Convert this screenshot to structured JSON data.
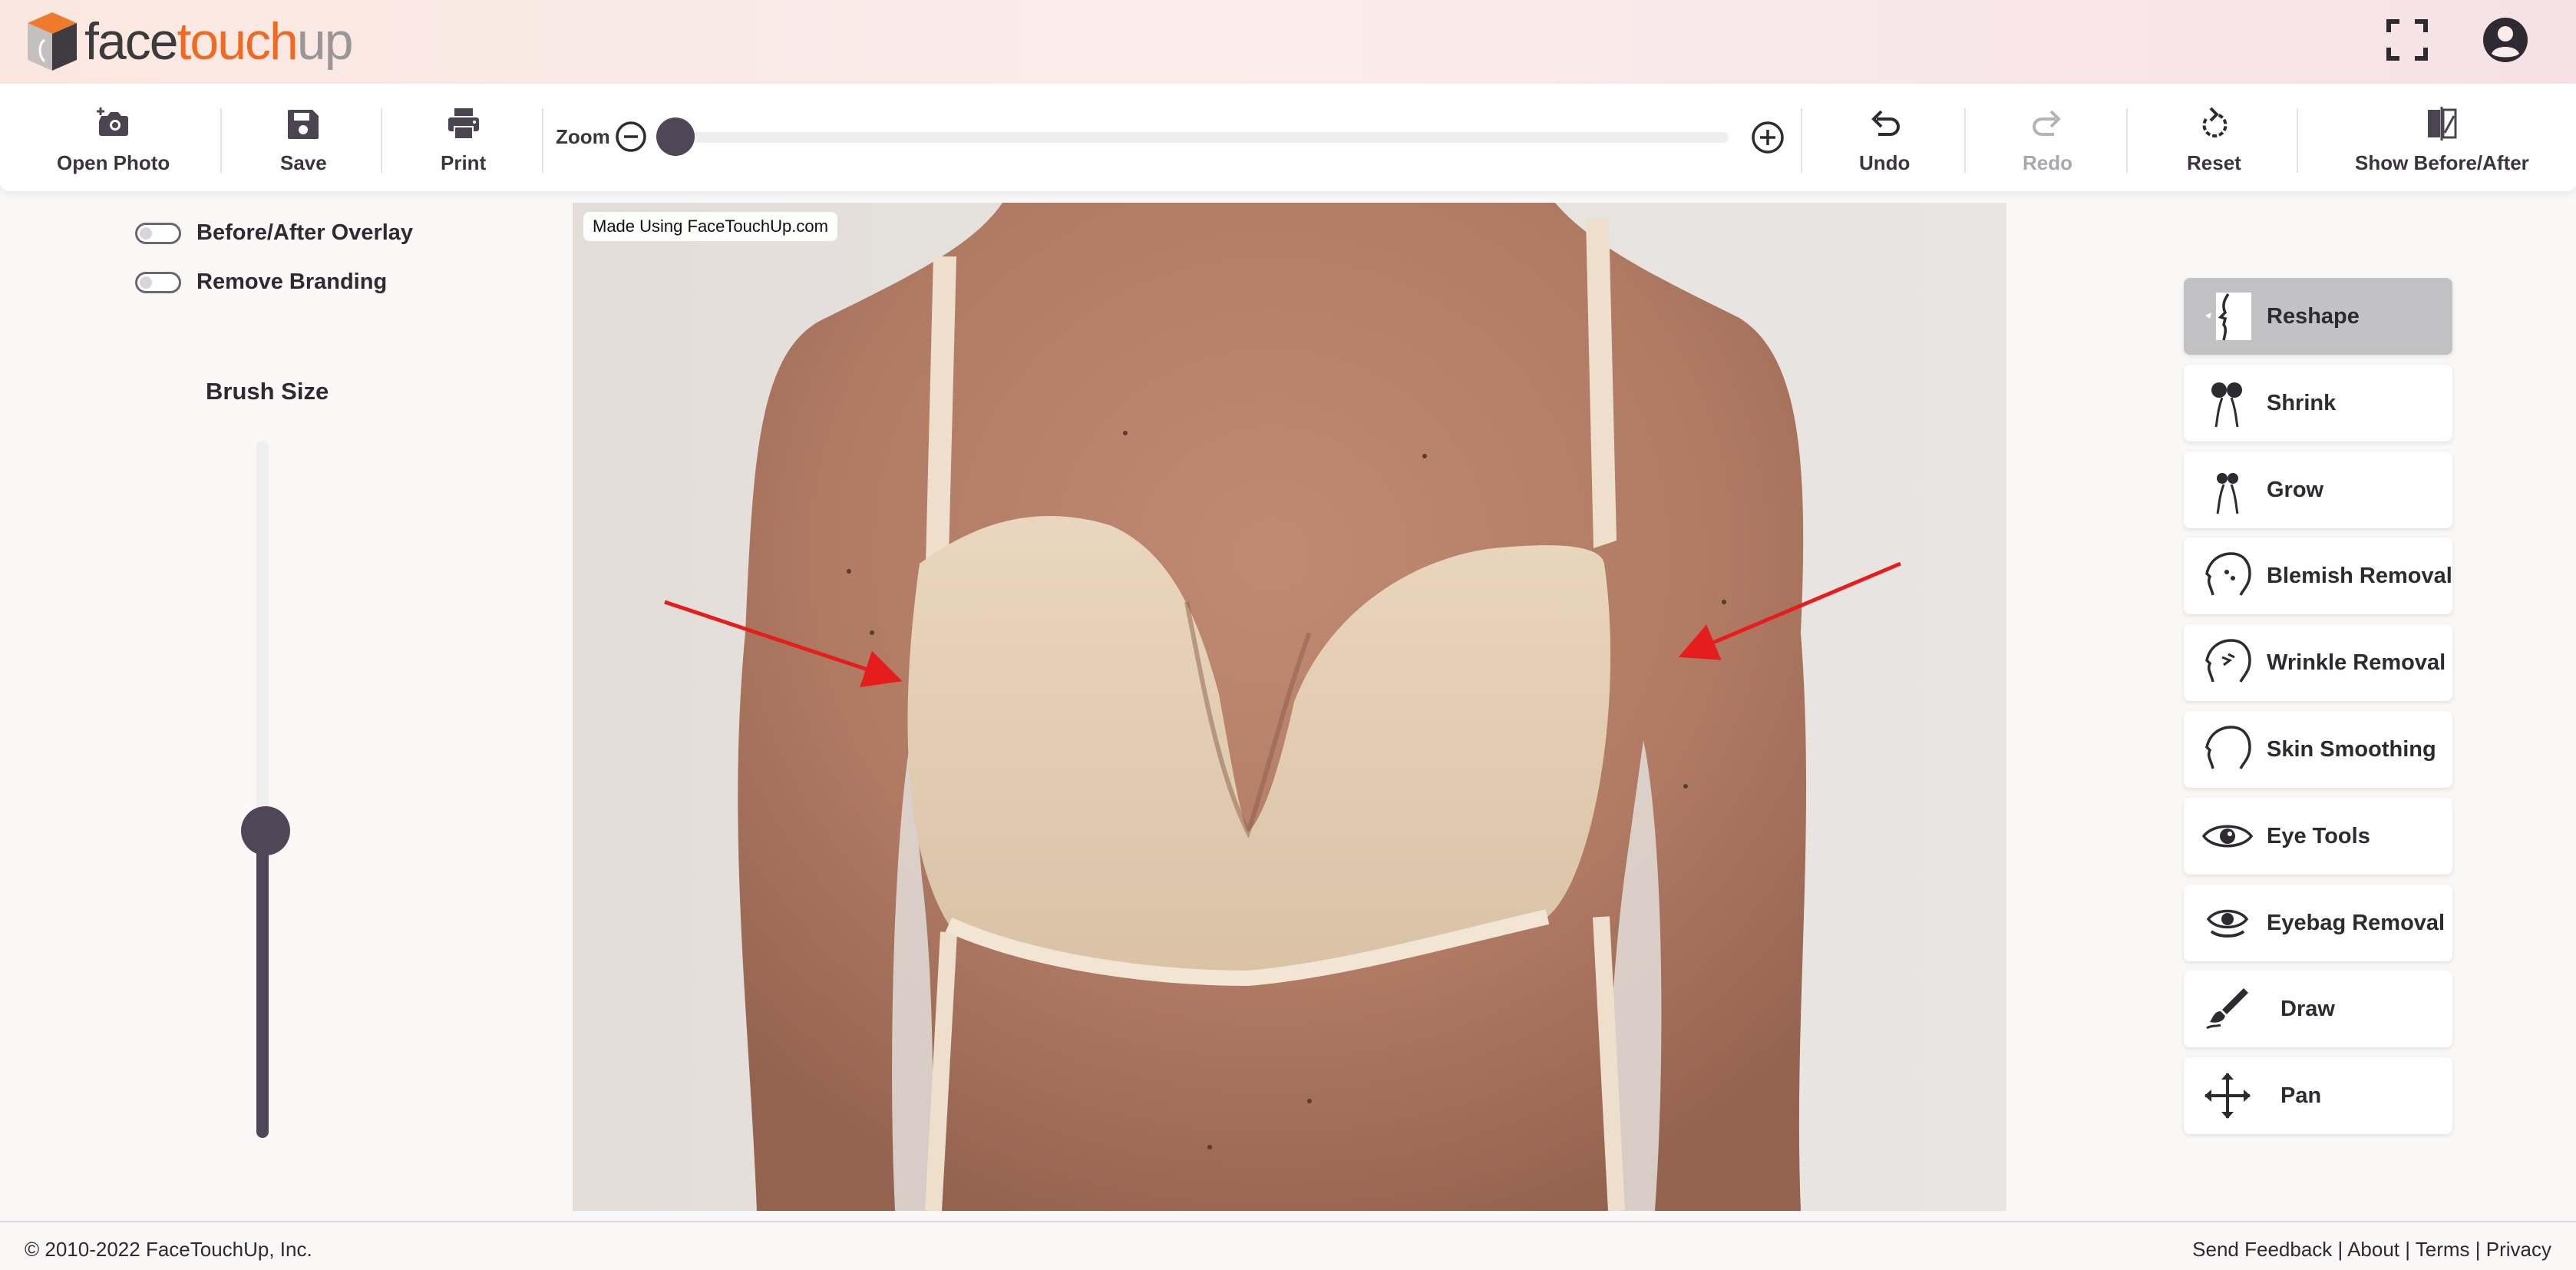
{
  "brand": {
    "part1": "face",
    "part2": "touch",
    "part3": "up",
    "colors": {
      "dark": "#3b3a3d",
      "orange": "#f06a24",
      "gray": "#9a9698"
    }
  },
  "header": {
    "fullscreen_icon": "fullscreen-icon",
    "account_icon": "account-circle-icon"
  },
  "toolbar": {
    "open_photo": "Open Photo",
    "save": "Save",
    "print": "Print",
    "zoom_label": "Zoom",
    "zoom_level": 0.0,
    "undo": "Undo",
    "redo": "Redo",
    "reset": "Reset",
    "show_before_after": "Show Before/After"
  },
  "left_panel": {
    "before_after_overlay": "Before/After Overlay",
    "before_after_overlay_on": false,
    "remove_branding": "Remove Branding",
    "remove_branding_on": false,
    "brush_size_title": "Brush Size",
    "brush_size_level": 0.44
  },
  "canvas": {
    "watermark": "Made Using FaceTouchUp.com",
    "arrow_color": "#e51d1d"
  },
  "tools": [
    {
      "label": "Reshape",
      "icon": "face-profile-reshape-icon",
      "active": true
    },
    {
      "label": "Shrink",
      "icon": "shrink-icon",
      "active": false
    },
    {
      "label": "Grow",
      "icon": "grow-icon",
      "active": false
    },
    {
      "label": "Blemish Removal",
      "icon": "head-blemish-icon",
      "active": false
    },
    {
      "label": "Wrinkle Removal",
      "icon": "head-wrinkle-icon",
      "active": false
    },
    {
      "label": "Skin Smoothing",
      "icon": "head-outline-icon",
      "active": false
    },
    {
      "label": "Eye Tools",
      "icon": "eye-icon",
      "active": false
    },
    {
      "label": "Eyebag Removal",
      "icon": "eyebag-icon",
      "active": false
    },
    {
      "label": "Draw",
      "icon": "brush-icon",
      "active": false
    },
    {
      "label": "Pan",
      "icon": "move-arrows-icon",
      "active": false
    }
  ],
  "footer": {
    "copyright": "© 2010-2022 FaceTouchUp, Inc.",
    "send_feedback": "Send Feedback",
    "about": "About",
    "terms": "Terms",
    "privacy": "Privacy",
    "separator": " | "
  },
  "accent": "#4f4757"
}
